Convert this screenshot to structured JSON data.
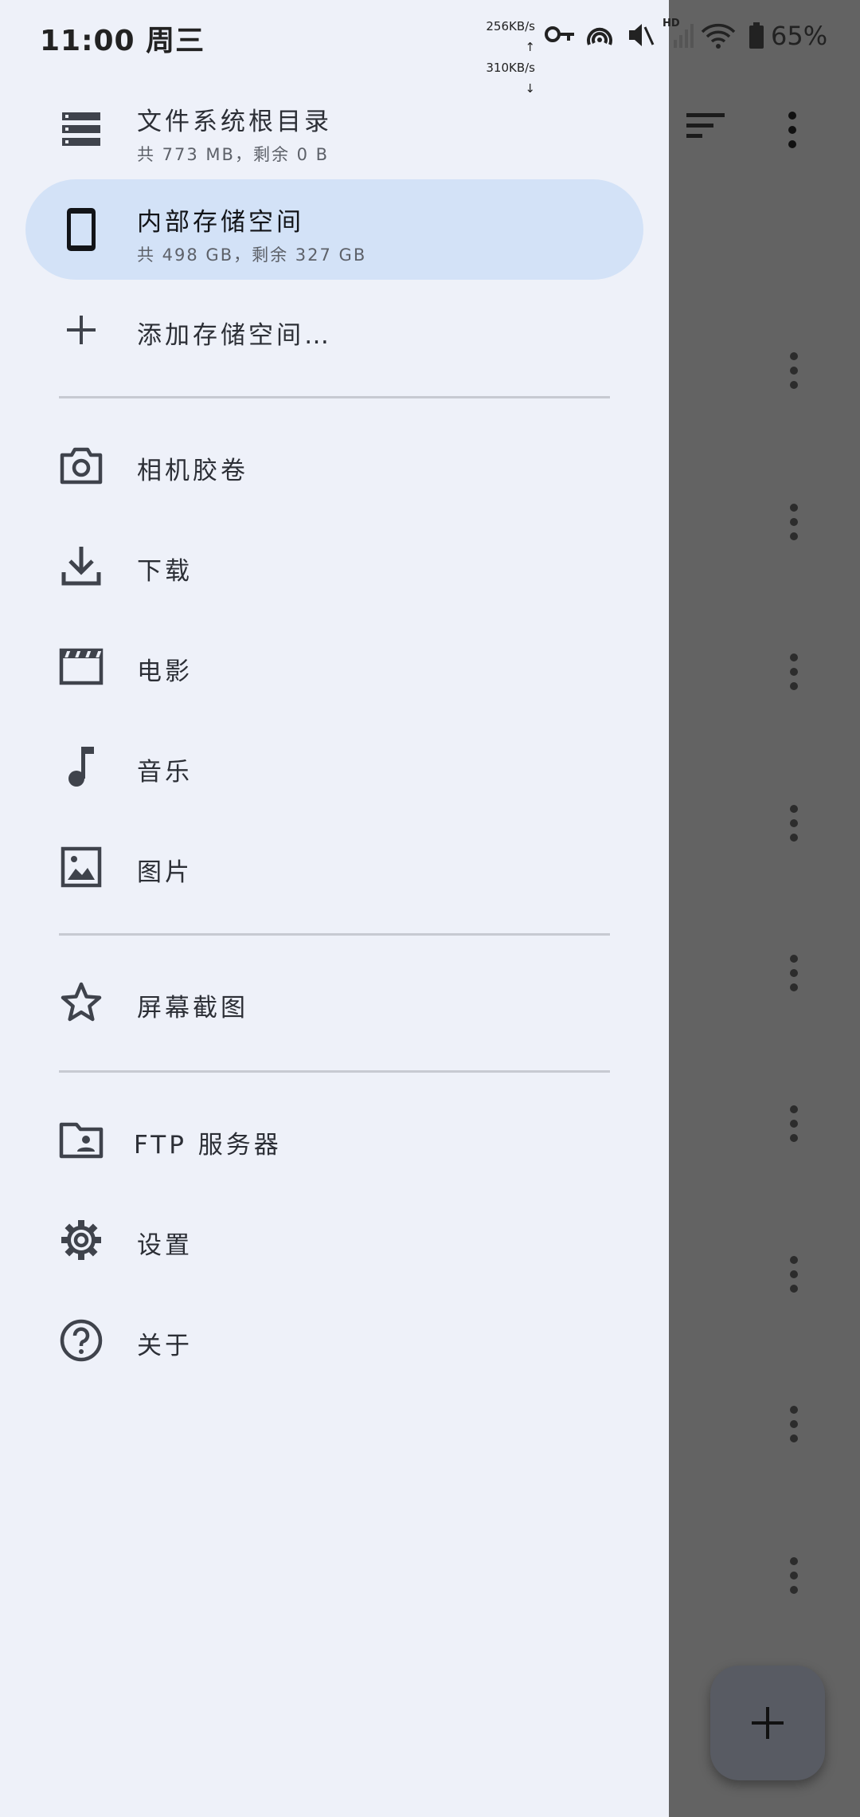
{
  "status_bar": {
    "time": "11:00 周三",
    "net_up": "256KB/s ↑",
    "net_down": "310KB/s ↓",
    "signal_label": "HD",
    "battery": "65%"
  },
  "drawer": {
    "storage": [
      {
        "label": "文件系统根目录",
        "sub": "共 773 MB，剩余 0 B",
        "icon": "storage-icon"
      },
      {
        "label": "内部存储空间",
        "sub": "共 498 GB，剩余 327 GB",
        "icon": "phone-icon",
        "selected": true
      },
      {
        "label": "添加存储空间…",
        "icon": "add-icon"
      }
    ],
    "folders": [
      {
        "label": "相机胶卷",
        "icon": "camera-icon"
      },
      {
        "label": "下载",
        "icon": "download-icon"
      },
      {
        "label": "电影",
        "icon": "movie-icon"
      },
      {
        "label": "音乐",
        "icon": "music-icon"
      },
      {
        "label": "图片",
        "icon": "image-icon"
      }
    ],
    "bookmarks": [
      {
        "label": "屏幕截图",
        "icon": "star-icon"
      }
    ],
    "other": [
      {
        "label": "FTP 服务器",
        "icon": "ftp-folder-icon"
      },
      {
        "label": "设置",
        "icon": "gear-icon"
      },
      {
        "label": "关于",
        "icon": "help-icon"
      }
    ]
  },
  "colors": {
    "drawer_bg": "#eef1f9",
    "selected_bg": "#d3e2f7",
    "scrim": "#636363",
    "icon": "#3f434c"
  }
}
